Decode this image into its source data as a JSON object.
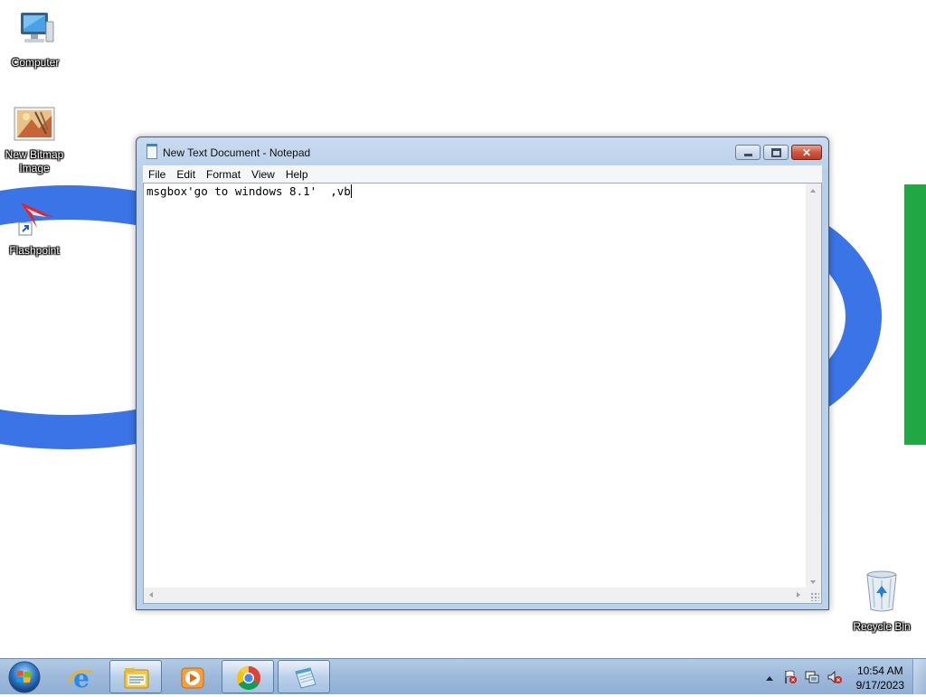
{
  "desktop": {
    "icons": [
      {
        "label": "Computer",
        "icon": "computer-icon"
      },
      {
        "label": "New Bitmap Image",
        "icon": "bitmap-image-icon"
      },
      {
        "label": "Flashpoint",
        "icon": "flashpoint-shortcut-icon"
      },
      {
        "label": "Recycle Bin",
        "icon": "recycle-bin-icon"
      }
    ]
  },
  "notepad": {
    "title": "New Text Document - Notepad",
    "menu": [
      "File",
      "Edit",
      "Format",
      "View",
      "Help"
    ],
    "content": "msgbox'go to windows 8.1'  ,vb"
  },
  "taskbar": {
    "pinned": [
      "start-orb",
      "internet-explorer",
      "windows-explorer",
      "media-player",
      "chrome",
      "notepad"
    ],
    "clock": {
      "time": "10:54 AM",
      "date": "9/17/2023"
    }
  },
  "colors": {
    "wallpaper_blue": "#3a74e6",
    "wallpaper_green": "#21a844",
    "close_red": "#c23a22"
  }
}
